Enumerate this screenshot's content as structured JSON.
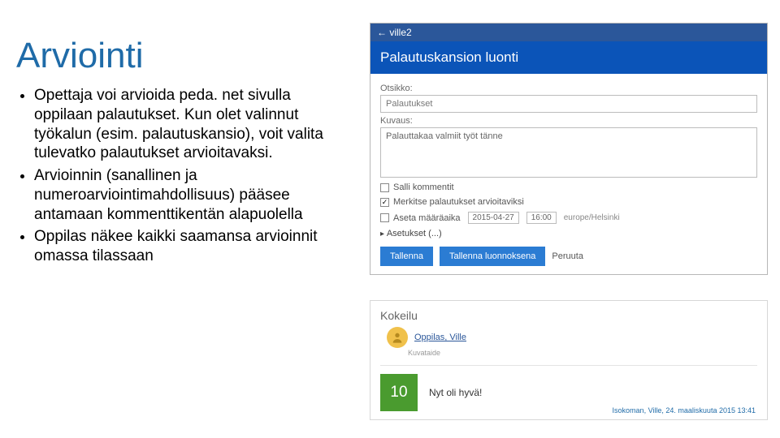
{
  "slide": {
    "title": "Arviointi",
    "bullets": [
      "Opettaja voi arvioida peda. net sivulla oppilaan palautukset. Kun olet valinnut työkalun (esim. palautuskansio), voit valita tulevatko palautukset arvioitavaksi.",
      "Arvioinnin (sanallinen ja numeroarviointimahdollisuus) pääsee antamaan kommenttikentän alapuolella",
      "Oppilas näkee kaikki saamansa arvioinnit omassa tilassaan"
    ]
  },
  "form": {
    "back": "← ville2",
    "header": "Palautuskansion luonti",
    "label_title": "Otsikko:",
    "value_title": "Palautukset",
    "label_desc": "Kuvaus:",
    "value_desc": "Palauttakaa valmiit työt tänne",
    "chk_comments": "Salli kommentit",
    "chk_mark": "Merkitse palautukset arvioitaviksi",
    "chk_deadline": "Aseta määräaika",
    "deadline_date": "2015-04-27",
    "deadline_time": "16:00",
    "timezone": "europe/Helsinki",
    "settings": "Asetukset (...)",
    "btn_save": "Tallenna",
    "btn_draft": "Tallenna luonnoksena",
    "btn_cancel": "Peruuta"
  },
  "feedback": {
    "title": "Kokeilu",
    "user": "Oppilas, Ville",
    "meta": "Kuvataide",
    "grade": "10",
    "comment": "Nyt oli hyvä!",
    "signature": "Isokoman, Ville, 24. maaliskuuta 2015 13:41"
  }
}
